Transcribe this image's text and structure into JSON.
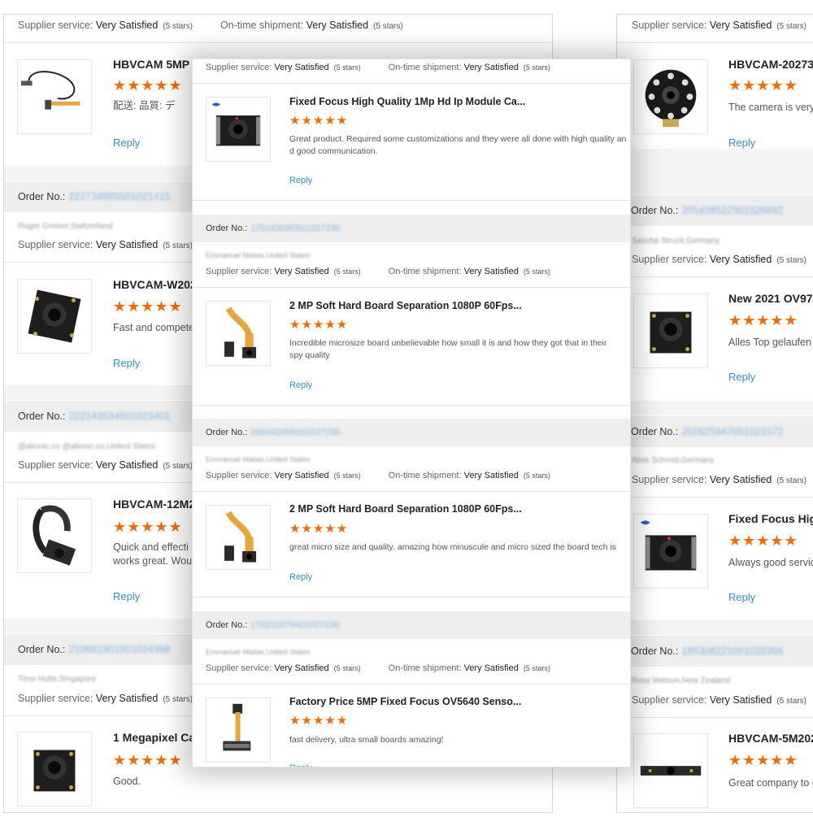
{
  "labels": {
    "supplier_service": "Supplier service:",
    "on_time_shipment": "On-time shipment:",
    "order_no": "Order No.:",
    "reply": "Reply",
    "rating_text": "Very Satisfied",
    "stars_text": "(5 stars)",
    "star_glyphs": "★★★★★"
  },
  "left_panel": {
    "reviews": [
      {
        "order_no": "",
        "buyer": "",
        "product_title": "HBVCAM 5MP",
        "review_text": "配送:    品質:    デ",
        "image": "usb-cable-camera-module"
      },
      {
        "order_no": "222734885501021415",
        "buyer": "Roger Greiser,Switzerland",
        "product_title": "HBVCAM-W202",
        "review_text": "Fast and compete",
        "image": "square-board-camera"
      },
      {
        "order_no": "222143534501023401",
        "buyer": "@alionic.co @alionic.co,United States",
        "product_title": "HBVCAM-12M2",
        "review_text": "Quick and effecti",
        "review_text2": "works great. Wou",
        "image": "flex-cable-camera"
      },
      {
        "order_no": "210681901001024998",
        "buyer": "Timo Holte,Singapore",
        "product_title": "1 Megapixel Ca",
        "review_text": "Good.",
        "image": "square-board-camera"
      }
    ]
  },
  "center_panel": {
    "reviews": [
      {
        "order_no": "",
        "buyer": "",
        "product_title": "Fixed Focus High Quality 1Mp Hd Ip Module Ca...",
        "review_text": "Great product. Required some customizations and they were all done with high quality an",
        "review_text2": "d good communication.",
        "image": "board-camera-logo"
      },
      {
        "order_no": "170183090501027230",
        "buyer": "Emmanuel Matias,United States",
        "product_title": "2 MP Soft Hard Board Separation 1080P 60Fps...",
        "review_text": "Incredible microsize board unbelievable how small it is and how they got that in their",
        "review_text2": "spy quality",
        "image": "flex-board-camera"
      },
      {
        "order_no": "168342055001027230",
        "buyer": "Emmanuel Matias,United States",
        "product_title": "2 MP Soft Hard Board Separation 1080P 60Fps...",
        "review_text": "great micro size and quality. amazing how minuscule and micro sized the board tech is",
        "review_text2": "",
        "image": "flex-board-camera"
      },
      {
        "order_no": "170211079401027230",
        "buyer": "Emmanuel Matias,United States",
        "product_title": "Factory Price 5MP Fixed Focus OV5640 Senso...",
        "review_text": "fast delivery, ultra small boards amazing!",
        "review_text2": "",
        "image": "long-flex-camera"
      }
    ]
  },
  "right_panel": {
    "reviews": [
      {
        "order_no": "",
        "buyer": "",
        "product_title": "HBVCAM-20273",
        "review_text": "The camera is very",
        "image": "ir-led-camera"
      },
      {
        "order_no": "205428522501026692",
        "buyer": "Sascha Struck,Germany",
        "product_title": "New 2021 OV973",
        "review_text": "Alles Top gelaufen",
        "image": "square-board-camera"
      },
      {
        "order_no": "202625947001021072",
        "buyer": "Alois Schmid,Germany",
        "product_title": "Fixed Focus High",
        "review_text": "Always good servic",
        "image": "board-camera-logo"
      },
      {
        "order_no": "185308221001020366",
        "buyer": "Ross Watson,New Zealand",
        "product_title": "HBVCAM-5M202",
        "review_text": "Great company to c",
        "image": "strip-camera"
      }
    ]
  }
}
